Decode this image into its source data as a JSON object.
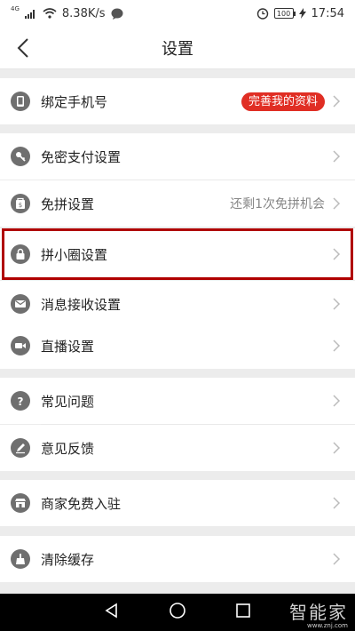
{
  "status_bar": {
    "signal_label": "4G",
    "speed": "8.38K/s",
    "battery": "100",
    "time": "17:54"
  },
  "header": {
    "title": "设置"
  },
  "settings": {
    "bind_phone": {
      "label": "绑定手机号",
      "badge": "完善我的资料"
    },
    "password_free_pay": {
      "label": "免密支付设置"
    },
    "free_group": {
      "label": "免拼设置",
      "hint": "还剩1次免拼机会"
    },
    "pin_circle": {
      "label": "拼小圈设置"
    },
    "message": {
      "label": "消息接收设置"
    },
    "live": {
      "label": "直播设置"
    },
    "faq": {
      "label": "常见问题"
    },
    "feedback": {
      "label": "意见反馈"
    },
    "merchant": {
      "label": "商家免费入驻"
    },
    "clear_cache": {
      "label": "清除缓存"
    }
  },
  "watermark": {
    "main": "智能家",
    "sub": "www.znj.com"
  },
  "colors": {
    "accent": "#e02e24",
    "highlight": "#b00000",
    "icon": "#6f6f6f"
  }
}
